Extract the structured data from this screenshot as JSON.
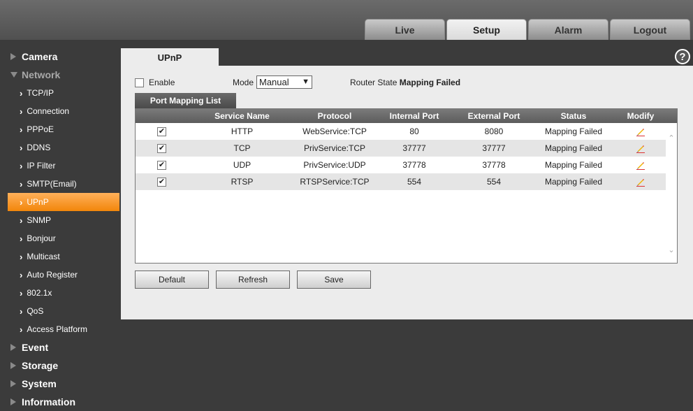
{
  "topnav": [
    "Live",
    "Setup",
    "Alarm",
    "Logout"
  ],
  "sidebar": {
    "camera": "Camera",
    "network": "Network",
    "network_items": [
      "TCP/IP",
      "Connection",
      "PPPoE",
      "DDNS",
      "IP Filter",
      "SMTP(Email)",
      "UPnP",
      "SNMP",
      "Bonjour",
      "Multicast",
      "Auto Register",
      "802.1x",
      "QoS",
      "Access Platform"
    ],
    "active_item": "UPnP",
    "event": "Event",
    "storage": "Storage",
    "system": "System",
    "information": "Information"
  },
  "page": {
    "title": "UPnP",
    "help": "?",
    "enable_label": "Enable",
    "enable_checked": false,
    "mode_label": "Mode",
    "mode_value": "Manual",
    "router_state_label": "Router State",
    "router_state_value": "Mapping Failed",
    "list_tab": "Port Mapping List"
  },
  "table": {
    "headers": [
      "Service Name",
      "Protocol",
      "Internal Port",
      "External Port",
      "Status",
      "Modify"
    ],
    "rows": [
      {
        "checked": true,
        "service": "HTTP",
        "protocol": "WebService:TCP",
        "internal": "80",
        "external": "8080",
        "status": "Mapping Failed"
      },
      {
        "checked": true,
        "service": "TCP",
        "protocol": "PrivService:TCP",
        "internal": "37777",
        "external": "37777",
        "status": "Mapping Failed"
      },
      {
        "checked": true,
        "service": "UDP",
        "protocol": "PrivService:UDP",
        "internal": "37778",
        "external": "37778",
        "status": "Mapping Failed"
      },
      {
        "checked": true,
        "service": "RTSP",
        "protocol": "RTSPService:TCP",
        "internal": "554",
        "external": "554",
        "status": "Mapping Failed"
      }
    ]
  },
  "buttons": {
    "default": "Default",
    "refresh": "Refresh",
    "save": "Save"
  },
  "colors": {
    "accent": "#f2860a",
    "background": "#3b3b3b",
    "panel": "#ececec"
  }
}
